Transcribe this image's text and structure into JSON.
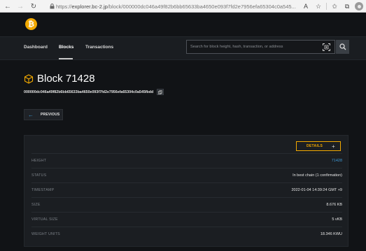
{
  "browser": {
    "url_prefix": "https://",
    "url_host": "explorer.bc-2.jp",
    "url_path": "/block/000000dc046a49f82b6bb65633ba4650e093f7fd2e7956efa65304c0a545..."
  },
  "header": {
    "logo_glyph": "₿"
  },
  "nav": {
    "dashboard": "Dashboard",
    "blocks": "Blocks",
    "transactions": "Transactions"
  },
  "search": {
    "placeholder": "Search for block height, hash, transaction, or address"
  },
  "block": {
    "title": "Block 71428",
    "hash": "000000dc046a49f82b6bb65633ba4650e093f7fd2e7956efa65304c0a545fbdd"
  },
  "buttons": {
    "previous": "PREVIOUS",
    "details": "DETAILS",
    "details_icon": "+"
  },
  "details": [
    {
      "key": "HEIGHT",
      "value": "71428"
    },
    {
      "key": "STATUS",
      "value": "In best chain (1 confirmation)"
    },
    {
      "key": "TIMESTAMP",
      "value": "2022-01-04 14:39:24 GMT +9"
    },
    {
      "key": "SIZE",
      "value": "8.676 KB"
    },
    {
      "key": "VIRTUAL SIZE",
      "value": "5 vKB"
    },
    {
      "key": "WEIGHT UNITS",
      "value": "18.346 KWU"
    }
  ],
  "colors": {
    "accent": "#f2a900",
    "link": "#3d9ad6",
    "background": "#111316"
  }
}
